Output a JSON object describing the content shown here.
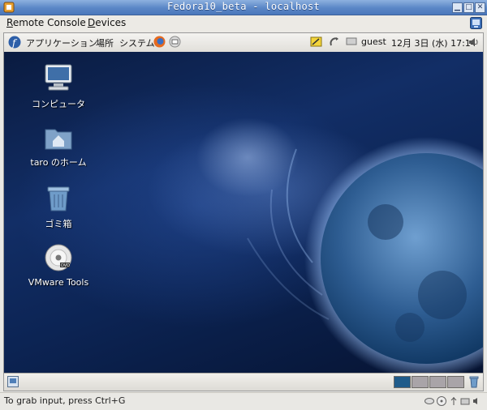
{
  "window": {
    "title": "Fedora10_beta - localhost",
    "minimize_glyph": "▁",
    "maximize_glyph": "□",
    "close_glyph": "✕"
  },
  "menubar": {
    "items": [
      {
        "label": "Remote Console",
        "mnemonic": "R"
      },
      {
        "label": "Devices",
        "mnemonic": "D"
      }
    ]
  },
  "guest_panel": {
    "applications": "アプリケーション",
    "places": "場所",
    "system": "システム",
    "user": "guest",
    "clock": "12月 3日 (水) 17:14"
  },
  "desktop_icons": [
    {
      "label": "コンピュータ",
      "icon": "computer-icon"
    },
    {
      "label": "taro のホーム",
      "icon": "home-folder-icon"
    },
    {
      "label": "ゴミ箱",
      "icon": "trash-icon"
    },
    {
      "label": "VMware Tools",
      "icon": "dvd-icon"
    }
  ],
  "workspaces": {
    "count": 4,
    "active": 1
  },
  "statusbar": {
    "message": "To grab input, press Ctrl+G"
  },
  "colors": {
    "titlebar": "#5a86c6",
    "desktop_bg": "#0c2454",
    "workspace_active": "#1f5b8a",
    "workspace_inactive": "#a9a4a8"
  }
}
